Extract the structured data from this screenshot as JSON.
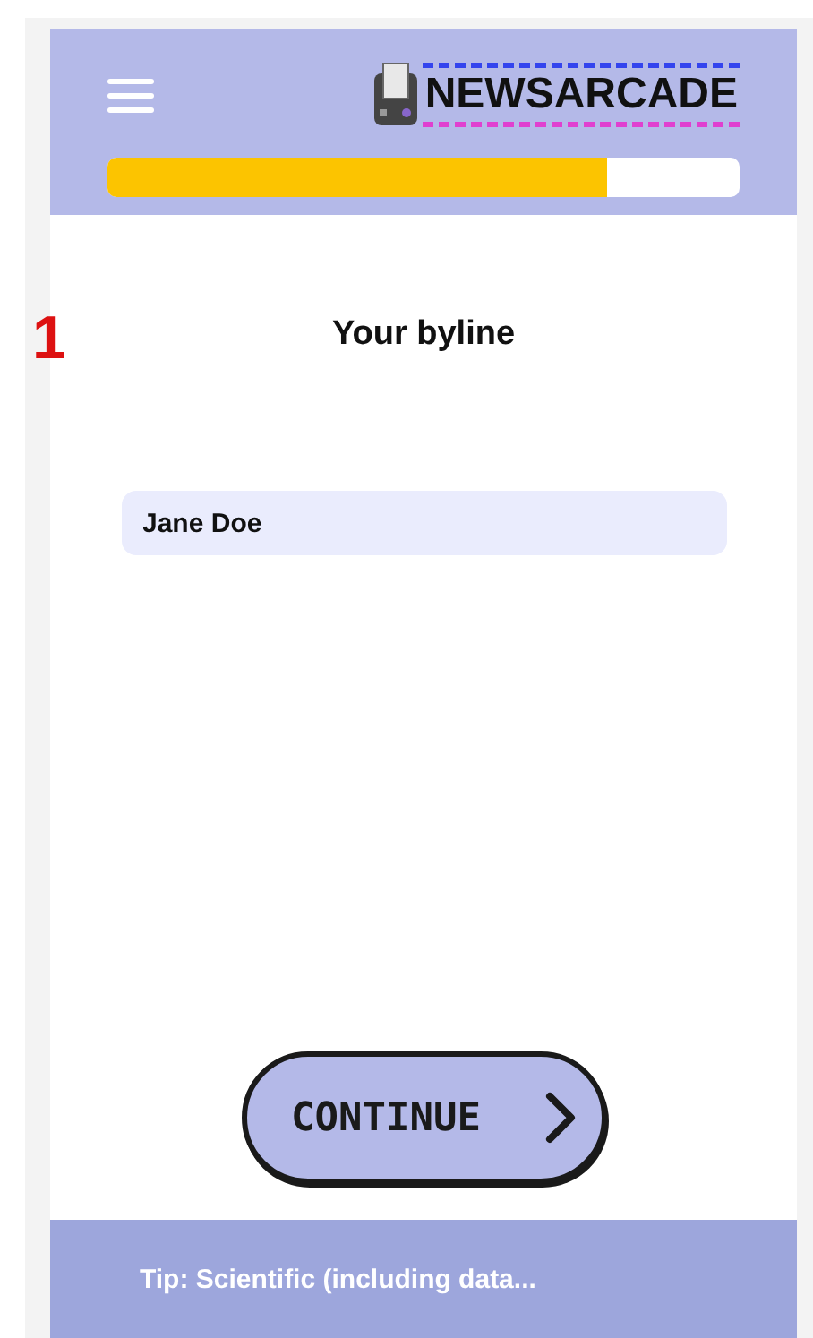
{
  "header": {
    "logo": "NEWSARCADE",
    "progress": {
      "level": 0.79
    }
  },
  "step_marker": "1",
  "title": "Your byline",
  "byline_field": {
    "value": "Jane Doe"
  },
  "continue_button": {
    "label": "CONTINUE"
  },
  "tip": "Tip: Scientific (including data..."
}
